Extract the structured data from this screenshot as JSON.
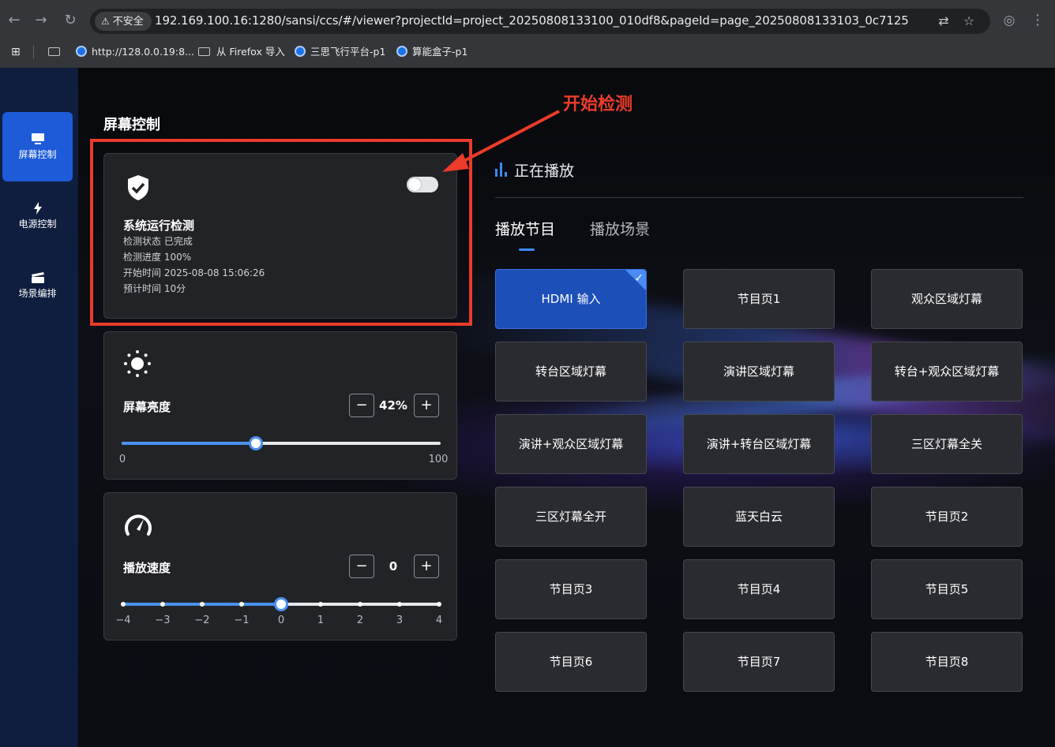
{
  "browser": {
    "insecure_label": "不安全",
    "url": "192.169.100.16:1280/sansi/ccs/#/viewer?projectId=project_20250808133100_010df8&pageId=page_20250808133103_0c7125",
    "bookmarks": [
      "http://128.0.0.19:8...",
      "从 Firefox 导入",
      "三思飞行平台-p1",
      "算能盒子-p1"
    ]
  },
  "sidebar": {
    "items": [
      {
        "label": "屏幕控制",
        "icon": "monitor-icon",
        "active": true
      },
      {
        "label": "电源控制",
        "icon": "lightning-icon",
        "active": false
      },
      {
        "label": "场景编排",
        "icon": "clapperboard-icon",
        "active": false
      }
    ]
  },
  "page_title": "屏幕控制",
  "annotation": {
    "text": "开始检测"
  },
  "detection": {
    "title": "系统运行检测",
    "lines": [
      "检测状态 已完成",
      "检测进度 100%",
      "开始时间 2025-08-08 15:06:26",
      "预计时间 10分"
    ],
    "toggle_on": false,
    "progress_percent": 100
  },
  "brightness": {
    "title": "屏幕亮度",
    "value_label": "42%",
    "value": 42,
    "min_label": "0",
    "max_label": "100",
    "min": 0,
    "max": 100
  },
  "speed": {
    "title": "播放速度",
    "value_label": "0",
    "value": 0,
    "ticks": [
      "−4",
      "−3",
      "−2",
      "−1",
      "0",
      "1",
      "2",
      "3",
      "4"
    ]
  },
  "now_playing": {
    "header": "正在播放",
    "tabs": [
      {
        "label": "播放节目",
        "active": true
      },
      {
        "label": "播放场景",
        "active": false
      }
    ],
    "programs": [
      {
        "label": "HDMI 输入",
        "selected": true
      },
      {
        "label": "节目页1",
        "selected": false
      },
      {
        "label": "观众区域灯幕",
        "selected": false
      },
      {
        "label": "转台区域灯幕",
        "selected": false
      },
      {
        "label": "演讲区域灯幕",
        "selected": false
      },
      {
        "label": "转台+观众区域灯幕",
        "selected": false
      },
      {
        "label": "演讲+观众区域灯幕",
        "selected": false
      },
      {
        "label": "演讲+转台区域灯幕",
        "selected": false
      },
      {
        "label": "三区灯幕全关",
        "selected": false
      },
      {
        "label": "三区灯幕全开",
        "selected": false
      },
      {
        "label": "蓝天白云",
        "selected": false
      },
      {
        "label": "节目页2",
        "selected": false
      },
      {
        "label": "节目页3",
        "selected": false
      },
      {
        "label": "节目页4",
        "selected": false
      },
      {
        "label": "节目页5",
        "selected": false
      },
      {
        "label": "节目页6",
        "selected": false
      },
      {
        "label": "节目页7",
        "selected": false
      },
      {
        "label": "节目页8",
        "selected": false
      }
    ]
  },
  "colors": {
    "accent": "#3d8bf5",
    "selected": "#1d4fb8",
    "annotation": "#ec3b2a",
    "sidebar": "#0f1d3f"
  }
}
